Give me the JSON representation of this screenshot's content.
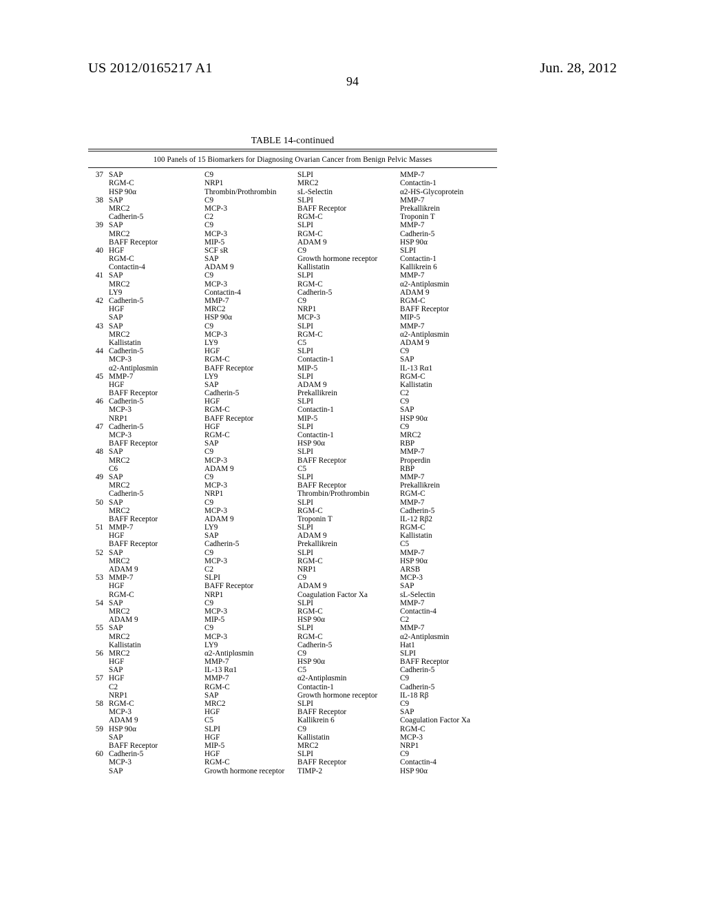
{
  "header": {
    "publication_number": "US 2012/0165217 A1",
    "publication_date": "Jun. 28, 2012",
    "page_number": "94"
  },
  "table": {
    "title": "TABLE 14-continued",
    "caption": "100 Panels of 15 Biomarkers for Diagnosing Ovarian Cancer from Benign Pelvic Masses",
    "panels": [
      {
        "index": "37",
        "lines": [
          [
            "SAP",
            "C9",
            "SLPI",
            "MMP-7"
          ],
          [
            "RGM-C",
            "NRP1",
            "MRC2",
            "Contactin-1"
          ],
          [
            "HSP 90α",
            "Thrombin/Prothrombin",
            "sL-Selectin",
            "α2-HS-Glycoprotein"
          ]
        ]
      },
      {
        "index": "38",
        "lines": [
          [
            "SAP",
            "C9",
            "SLPI",
            "MMP-7"
          ],
          [
            "MRC2",
            "MCP-3",
            "BAFF Receptor",
            "Prekallikrein"
          ],
          [
            "Cadherin-5",
            "C2",
            "RGM-C",
            "Troponin T"
          ]
        ]
      },
      {
        "index": "39",
        "lines": [
          [
            "SAP",
            "C9",
            "SLPI",
            "MMP-7"
          ],
          [
            "MRC2",
            "MCP-3",
            "RGM-C",
            "Cadherin-5"
          ],
          [
            "BAFF Receptor",
            "MIP-5",
            "ADAM 9",
            "HSP 90α"
          ]
        ]
      },
      {
        "index": "40",
        "lines": [
          [
            "HGF",
            "SCF sR",
            "C9",
            "SLPI"
          ],
          [
            "RGM-C",
            "SAP",
            "Growth hormone receptor",
            "Contactin-1"
          ],
          [
            "Contactin-4",
            "ADAM 9",
            "Kallistatin",
            "Kallikrein 6"
          ]
        ]
      },
      {
        "index": "41",
        "lines": [
          [
            "SAP",
            "C9",
            "SLPI",
            "MMP-7"
          ],
          [
            "MRC2",
            "MCP-3",
            "RGM-C",
            "α2-Antiplαsmin"
          ],
          [
            "LY9",
            "Contactin-4",
            "Cadherin-5",
            "ADAM 9"
          ]
        ]
      },
      {
        "index": "42",
        "lines": [
          [
            "Cadherin-5",
            "MMP-7",
            "C9",
            "RGM-C"
          ],
          [
            "HGF",
            "MRC2",
            "NRP1",
            "BAFF Receptor"
          ],
          [
            "SAP",
            "HSP 90α",
            "MCP-3",
            "MIP-5"
          ]
        ]
      },
      {
        "index": "43",
        "lines": [
          [
            "SAP",
            "C9",
            "SLPI",
            "MMP-7"
          ],
          [
            "MRC2",
            "MCP-3",
            "RGM-C",
            "α2-Antiplαsmin"
          ],
          [
            "Kallistatin",
            "LY9",
            "C5",
            "ADAM 9"
          ]
        ]
      },
      {
        "index": "44",
        "lines": [
          [
            "Cadherin-5",
            "HGF",
            "SLPI",
            "C9"
          ],
          [
            "MCP-3",
            "RGM-C",
            "Contactin-1",
            "SAP"
          ],
          [
            "α2-Antiplαsmin",
            "BAFF Receptor",
            "MIP-5",
            "IL-13 Rα1"
          ]
        ]
      },
      {
        "index": "45",
        "lines": [
          [
            "MMP-7",
            "LY9",
            "SLPI",
            "RGM-C"
          ],
          [
            "HGF",
            "SAP",
            "ADAM 9",
            "Kallistatin"
          ],
          [
            "BAFF Receptor",
            "Cadherin-5",
            "Prekallikrein",
            "C2"
          ]
        ]
      },
      {
        "index": "46",
        "lines": [
          [
            "Cadherin-5",
            "HGF",
            "SLPI",
            "C9"
          ],
          [
            "MCP-3",
            "RGM-C",
            "Contactin-1",
            "SAP"
          ],
          [
            "NRP1",
            "BAFF Receptor",
            "MIP-5",
            "HSP 90α"
          ]
        ]
      },
      {
        "index": "47",
        "lines": [
          [
            "Cadherin-5",
            "HGF",
            "SLPI",
            "C9"
          ],
          [
            "MCP-3",
            "RGM-C",
            "Contactin-1",
            "MRC2"
          ],
          [
            "BAFF Receptor",
            "SAP",
            "HSP 90α",
            "RBP"
          ]
        ]
      },
      {
        "index": "48",
        "lines": [
          [
            "SAP",
            "C9",
            "SLPI",
            "MMP-7"
          ],
          [
            "MRC2",
            "MCP-3",
            "BAFF Receptor",
            "Properdin"
          ],
          [
            "C6",
            "ADAM 9",
            "C5",
            "RBP"
          ]
        ]
      },
      {
        "index": "49",
        "lines": [
          [
            "SAP",
            "C9",
            "SLPI",
            "MMP-7"
          ],
          [
            "MRC2",
            "MCP-3",
            "BAFF Receptor",
            "Prekallikrein"
          ],
          [
            "Cadherin-5",
            "NRP1",
            "Thrombin/Prothrombin",
            "RGM-C"
          ]
        ]
      },
      {
        "index": "50",
        "lines": [
          [
            "SAP",
            "C9",
            "SLPI",
            "MMP-7"
          ],
          [
            "MRC2",
            "MCP-3",
            "RGM-C",
            "Cadherin-5"
          ],
          [
            "BAFF Receptor",
            "ADAM 9",
            "Troponin T",
            "IL-12 Rβ2"
          ]
        ]
      },
      {
        "index": "51",
        "lines": [
          [
            "MMP-7",
            "LY9",
            "SLPI",
            "RGM-C"
          ],
          [
            "HGF",
            "SAP",
            "ADAM 9",
            "Kallistatin"
          ],
          [
            "BAFF Receptor",
            "Cadherin-5",
            "Prekallikrein",
            "C5"
          ]
        ]
      },
      {
        "index": "52",
        "lines": [
          [
            "SAP",
            "C9",
            "SLPI",
            "MMP-7"
          ],
          [
            "MRC2",
            "MCP-3",
            "RGM-C",
            "HSP 90α"
          ],
          [
            "ADAM 9",
            "C2",
            "NRP1",
            "ARSB"
          ]
        ]
      },
      {
        "index": "53",
        "lines": [
          [
            "MMP-7",
            "SLPI",
            "C9",
            "MCP-3"
          ],
          [
            "HGF",
            "BAFF Receptor",
            "ADAM 9",
            "SAP"
          ],
          [
            "RGM-C",
            "NRP1",
            "Coagulation Factor Xa",
            "sL-Selectin"
          ]
        ]
      },
      {
        "index": "54",
        "lines": [
          [
            "SAP",
            "C9",
            "SLPI",
            "MMP-7"
          ],
          [
            "MRC2",
            "MCP-3",
            "RGM-C",
            "Contactin-4"
          ],
          [
            "ADAM 9",
            "MIP-5",
            "HSP 90α",
            "C2"
          ]
        ]
      },
      {
        "index": "55",
        "lines": [
          [
            "SAP",
            "C9",
            "SLPI",
            "MMP-7"
          ],
          [
            "MRC2",
            "MCP-3",
            "RGM-C",
            "α2-Antiplαsmin"
          ],
          [
            "Kallistatin",
            "LY9",
            "Cadherin-5",
            "Hat1"
          ]
        ]
      },
      {
        "index": "56",
        "lines": [
          [
            "MRC2",
            "α2-Antiplαsmin",
            "C9",
            "SLPI"
          ],
          [
            "HGF",
            "MMP-7",
            "HSP 90α",
            "BAFF Receptor"
          ],
          [
            "SAP",
            "IL-13 Rα1",
            "C5",
            "Cadherin-5"
          ]
        ]
      },
      {
        "index": "57",
        "lines": [
          [
            "HGF",
            "MMP-7",
            "α2-Antiplαsmin",
            "C9"
          ],
          [
            "C2",
            "RGM-C",
            "Contactin-1",
            "Cadherin-5"
          ],
          [
            "NRP1",
            "SAP",
            "Growth hormone receptor",
            "IL-18 Rβ"
          ]
        ]
      },
      {
        "index": "58",
        "lines": [
          [
            "RGM-C",
            "MRC2",
            "SLPI",
            "C9"
          ],
          [
            "MCP-3",
            "HGF",
            "BAFF Receptor",
            "SAP"
          ],
          [
            "ADAM 9",
            "C5",
            "Kallikrein 6",
            "Coagulation Factor Xa"
          ]
        ]
      },
      {
        "index": "59",
        "lines": [
          [
            "HSP 90α",
            "SLPI",
            "C9",
            "RGM-C"
          ],
          [
            "SAP",
            "HGF",
            "Kallistatin",
            "MCP-3"
          ],
          [
            "BAFF Receptor",
            "MIP-5",
            "MRC2",
            "NRP1"
          ]
        ]
      },
      {
        "index": "60",
        "lines": [
          [
            "Cadherin-5",
            "HGF",
            "SLPI",
            "C9"
          ],
          [
            "MCP-3",
            "RGM-C",
            "BAFF Receptor",
            "Contactin-4"
          ],
          [
            "SAP",
            "Growth hormone receptor",
            "TIMP-2",
            "HSP 90α"
          ]
        ]
      }
    ]
  }
}
